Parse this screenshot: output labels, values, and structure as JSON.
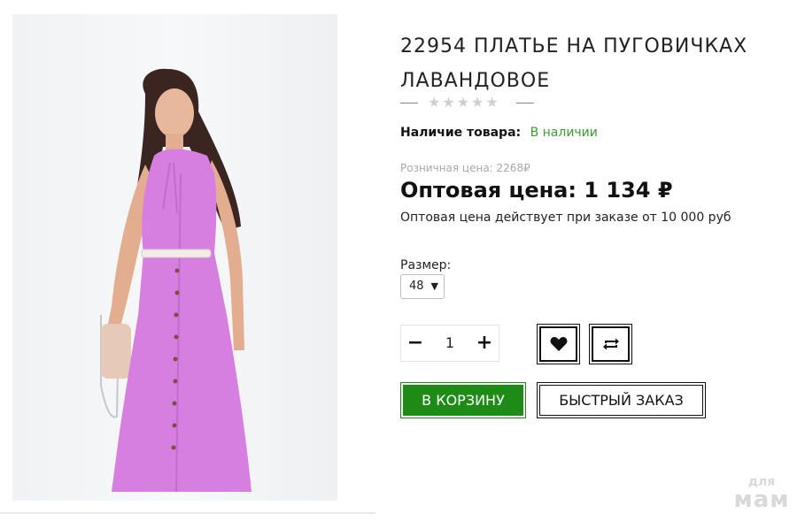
{
  "product": {
    "title": "22954 ПЛАТЬЕ НА ПУГОВИЧКАХ ЛАВАНДОВОЕ",
    "rating_stars": "★★★★★",
    "stock_label": "Наличие товара:",
    "stock_value": "В наличии",
    "retail_price": "Розничная цена: 2268₽",
    "wholesale_price": "Оптовая цена: 1 134 ₽",
    "wholesale_note": "Оптовая цена действует при заказе от 10 000 руб",
    "size_label": "Размер:",
    "size_selected": "48",
    "quantity": "1",
    "add_to_cart_label": "В КОРЗИНУ",
    "quick_order_label": "БЫСТРЫЙ ЗАКАЗ"
  },
  "icons": {
    "minus": "minus-icon",
    "plus": "plus-icon",
    "favorite": "heart-icon",
    "compare": "compare-icon"
  },
  "colors": {
    "accent_green": "#1f8b17",
    "stock_green": "#3a9b2f",
    "dress_lavender": "#d67fe0"
  },
  "watermark": {
    "small": "для",
    "big": "мам"
  }
}
